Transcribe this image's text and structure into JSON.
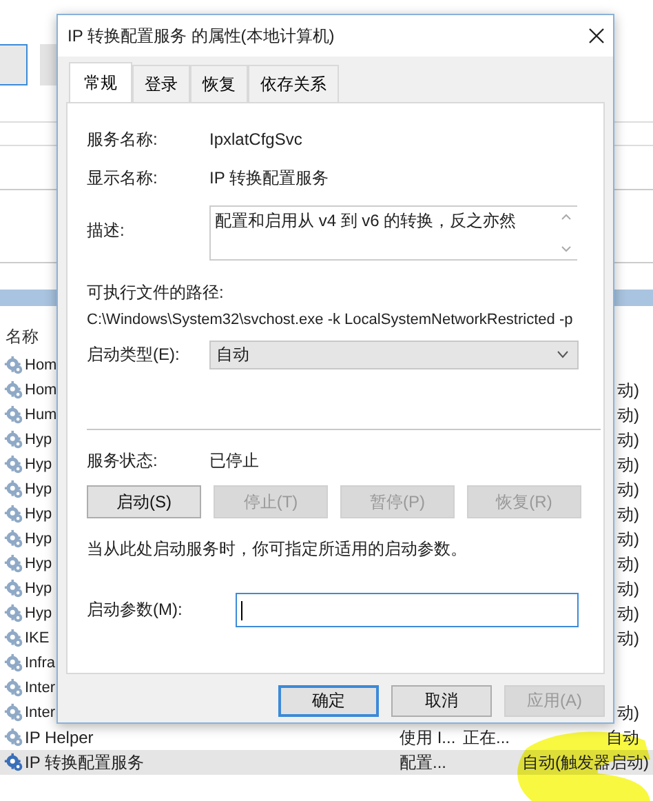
{
  "services_list": {
    "columns": [
      "名称"
    ],
    "rows": [
      {
        "name": "Hom",
        "selected": false
      },
      {
        "name": "Hom",
        "startup": "动)",
        "selected": false
      },
      {
        "name": "Hum",
        "startup": "动)",
        "selected": false
      },
      {
        "name": "Hyp",
        "startup": "动)",
        "selected": false
      },
      {
        "name": "Hyp",
        "startup": "动)",
        "selected": false
      },
      {
        "name": "Hyp",
        "startup": "动)",
        "selected": false
      },
      {
        "name": "Hyp",
        "startup": "动)",
        "selected": false
      },
      {
        "name": "Hyp",
        "startup": "动)",
        "selected": false
      },
      {
        "name": "Hyp",
        "startup": "动)",
        "selected": false
      },
      {
        "name": "Hyp",
        "startup": "动)",
        "selected": false
      },
      {
        "name": "Hyp",
        "startup": "动)",
        "selected": false
      },
      {
        "name": "IKE",
        "startup": "动)",
        "selected": false
      },
      {
        "name": "Infra",
        "selected": false
      },
      {
        "name": "Inter",
        "selected": false
      },
      {
        "name": "Inter",
        "startup": "动)",
        "selected": false
      },
      {
        "name": "IP Helper",
        "description": "使用 I...",
        "status": "正在...",
        "startup": "自动",
        "selected": false
      },
      {
        "name": "IP 转换配置服务",
        "description": "配置...",
        "startup": "自动(触发器启动)",
        "selected": true
      }
    ]
  },
  "dialog": {
    "title": "IP 转换配置服务 的属性(本地计算机)",
    "tabs": [
      {
        "label": "常规",
        "selected": true
      },
      {
        "label": "登录",
        "selected": false
      },
      {
        "label": "恢复",
        "selected": false
      },
      {
        "label": "依存关系",
        "selected": false
      }
    ],
    "service_name": {
      "label": "服务名称:",
      "value": "IpxlatCfgSvc"
    },
    "display_name": {
      "label": "显示名称:",
      "value": "IP 转换配置服务"
    },
    "description": {
      "label": "描述:",
      "value": "配置和启用从 v4 到 v6 的转换，反之亦然"
    },
    "executable_path": {
      "label": "可执行文件的路径:",
      "value": "C:\\Windows\\System32\\svchost.exe -k LocalSystemNetworkRestricted -p"
    },
    "startup_type": {
      "label": "启动类型(E):",
      "value": "自动"
    },
    "service_status": {
      "label": "服务状态:",
      "value": "已停止"
    },
    "control_buttons": [
      {
        "label": "启动(S)",
        "disabled": false
      },
      {
        "label": "停止(T)",
        "disabled": true
      },
      {
        "label": "暂停(P)",
        "disabled": true
      },
      {
        "label": "恢复(R)",
        "disabled": true
      }
    ],
    "hint": "当从此处启动服务时，你可指定所适用的启动参数。",
    "start_parameters": {
      "label": "启动参数(M):",
      "focused": true
    },
    "footer_buttons": [
      {
        "label": "确定",
        "default": true,
        "disabled": false
      },
      {
        "label": "取消",
        "default": false,
        "disabled": false
      },
      {
        "label": "应用(A)",
        "default": false,
        "disabled": true
      }
    ]
  }
}
